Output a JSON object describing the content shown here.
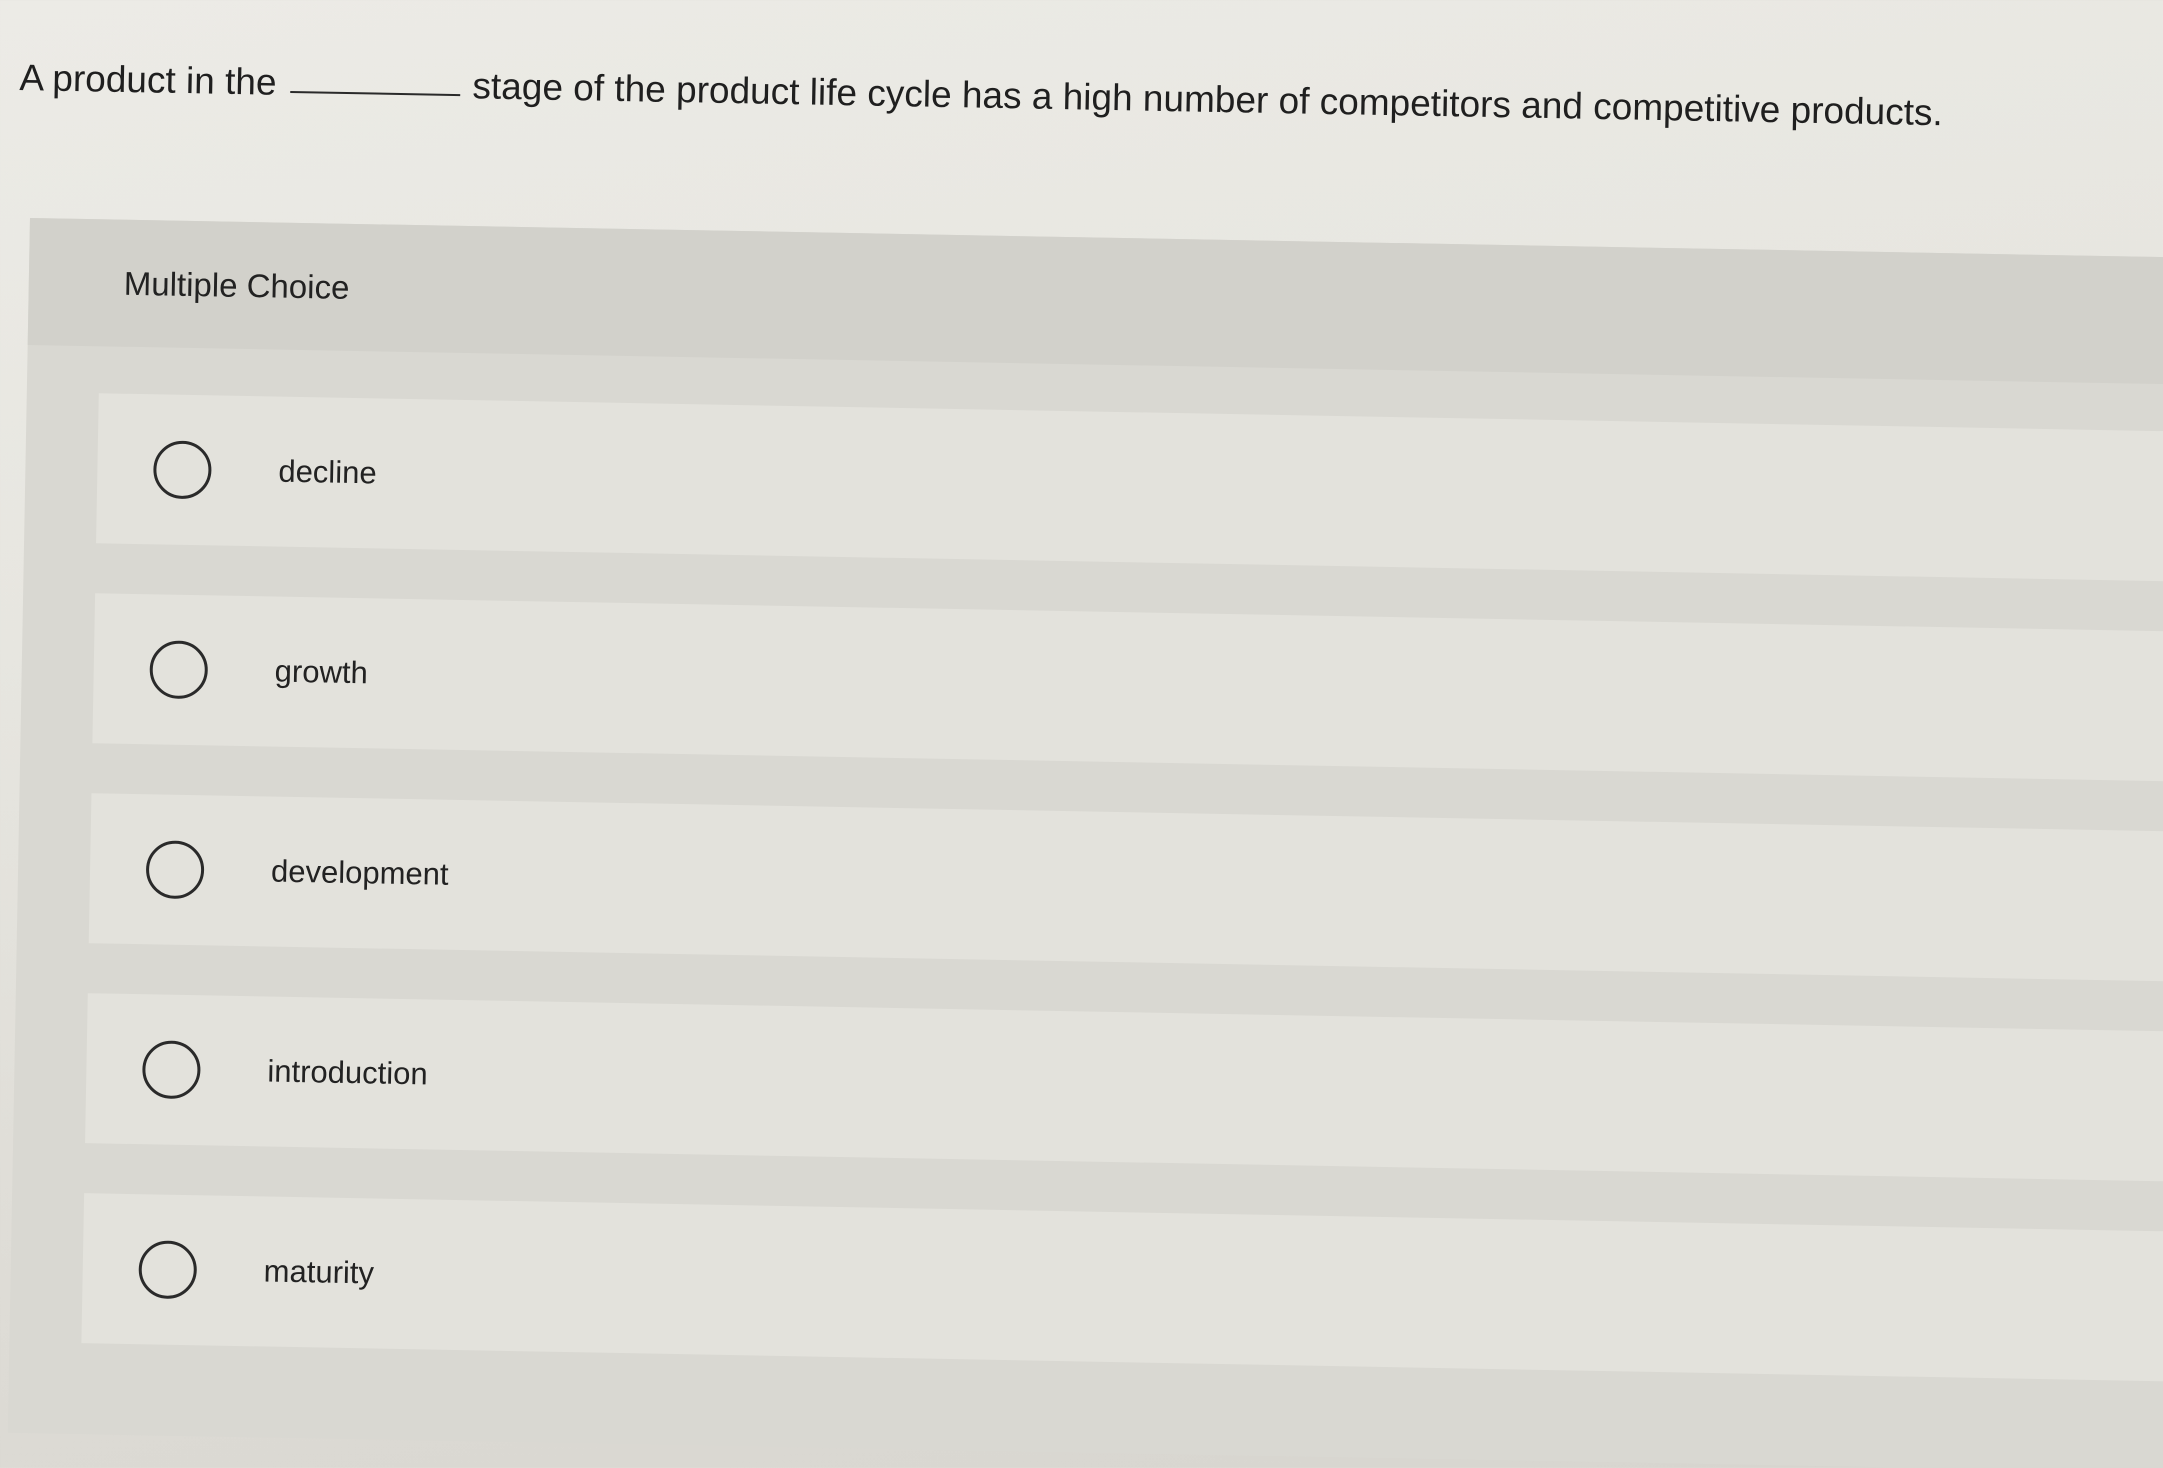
{
  "question": {
    "before_blank": "A product in the",
    "after_blank": "stage of the product life cycle has a high number of competitors and competitive products."
  },
  "multiple_choice": {
    "header": "Multiple Choice",
    "options": [
      {
        "label": "decline"
      },
      {
        "label": "growth"
      },
      {
        "label": "development"
      },
      {
        "label": "introduction"
      },
      {
        "label": "maturity"
      }
    ]
  }
}
